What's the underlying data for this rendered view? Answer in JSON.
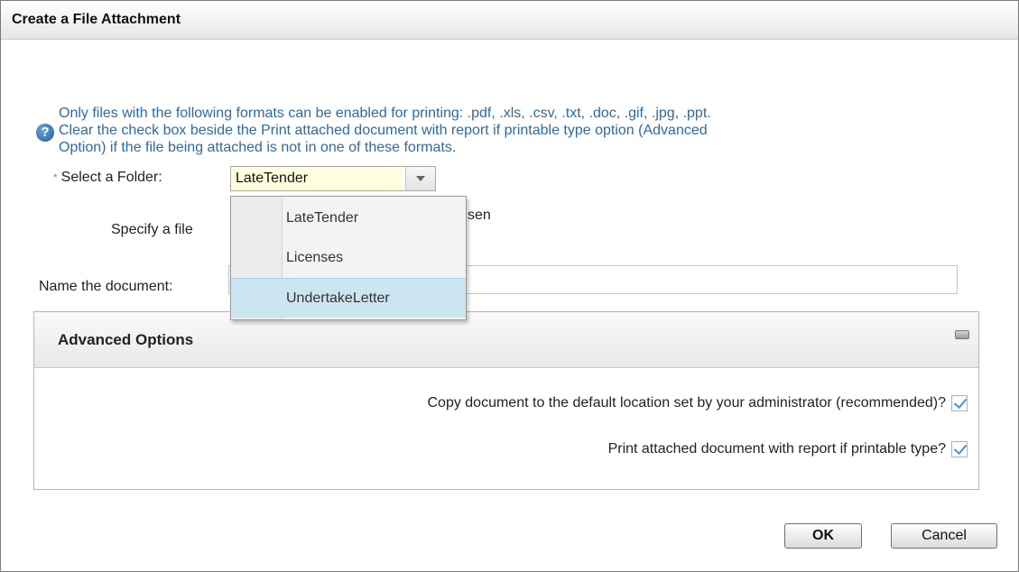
{
  "dialog": {
    "title": "Create a File Attachment"
  },
  "info": {
    "icon": "help-question-icon",
    "lines": [
      "Only files with the following formats can be enabled for printing: .pdf, .xls, .csv, .txt, .doc, .gif, .jpg, .ppt.",
      "Clear the check box beside the Print attached document with report if printable type option (Advanced",
      "Option) if the file being attached is not in one of these formats."
    ]
  },
  "folder": {
    "label": "Select a Folder:",
    "required_marker": "*",
    "selected": "LateTender",
    "options": [
      "LateTender",
      "Licenses",
      "UndertakeLetter"
    ],
    "highlighted_option": "UndertakeLetter"
  },
  "file": {
    "label": "Specify a file",
    "status_fragment": "sen"
  },
  "document_name": {
    "label": "Name the document:",
    "value": ""
  },
  "advanced": {
    "title": "Advanced Options",
    "options": [
      {
        "label": "Copy document to the default location set by your administrator (recommended)?",
        "checked": true
      },
      {
        "label": "Print attached document with report if printable type?",
        "checked": true
      }
    ]
  },
  "buttons": {
    "ok": "OK",
    "cancel": "Cancel"
  },
  "colors": {
    "info_text": "#2e6aa5",
    "highlight": "#cce6f1",
    "select_value_bg": "#ffffe0"
  }
}
